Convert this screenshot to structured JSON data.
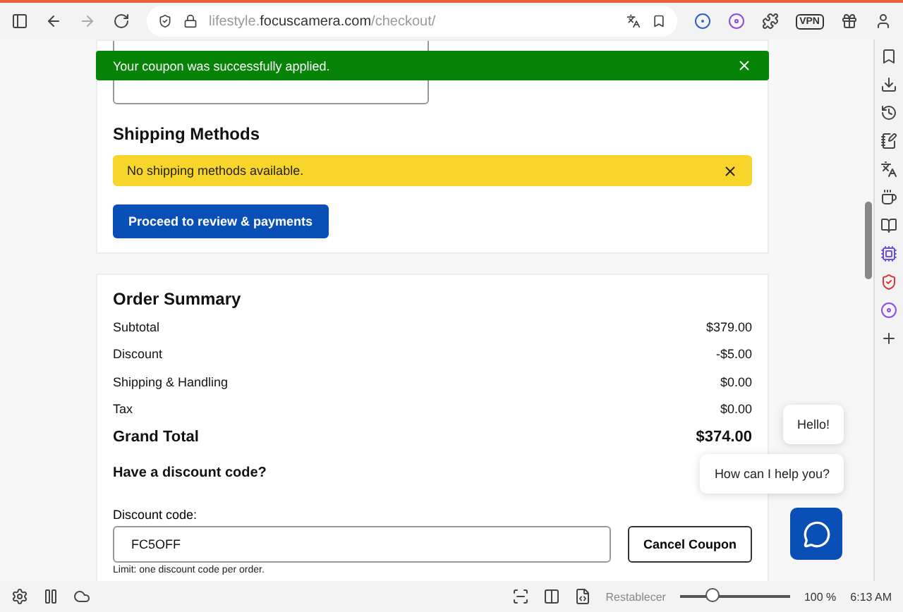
{
  "browser": {
    "url_subdomain": "lifestyle.",
    "url_domain": "focuscamera.com",
    "url_path": "/checkout/",
    "vpn_label": "VPN"
  },
  "toast": {
    "message": "Your coupon was successfully applied."
  },
  "shipping": {
    "title": "Shipping Methods",
    "notice": "No shipping methods available.",
    "button": "Proceed to review & payments"
  },
  "order_summary": {
    "title": "Order Summary",
    "rows": [
      {
        "label": "Subtotal",
        "value": "$379.00",
        "kind": "normal"
      },
      {
        "label": "Discount",
        "value": "-$5.00",
        "kind": "normal"
      },
      {
        "label": "Shipping & Handling",
        "value": "$0.00",
        "kind": "normal"
      },
      {
        "label": "Tax",
        "value": "$0.00",
        "kind": "normal"
      },
      {
        "label": "Grand Total",
        "value": "$374.00",
        "kind": "total"
      }
    ]
  },
  "discount": {
    "title": "Have a discount code?",
    "field_label": "Discount code:",
    "value": "FC5OFF",
    "button": "Cancel Coupon",
    "note": "Limit: one discount code per order."
  },
  "chat": {
    "messages": [
      "Hello!",
      "How can I help you?"
    ]
  },
  "status_bar": {
    "reset": "Restablecer",
    "zoom": {
      "level": 0.3
    },
    "zoom_reading": "100 %",
    "clock": "6:13 AM"
  }
}
